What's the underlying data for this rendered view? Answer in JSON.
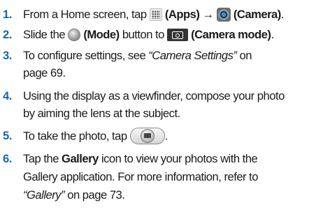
{
  "accent_color": "#1565b5",
  "steps": [
    {
      "num": "1.",
      "line1": {
        "t1": "From a Home screen, tap ",
        "apps": "(Apps)",
        "arrow": " → ",
        "camera": "(Camera)",
        "end": "."
      }
    },
    {
      "num": "2.",
      "line1": {
        "t1": "Slide the ",
        "mode": "(Mode)",
        "t2": " button to ",
        "camera_mode": "(Camera mode)",
        "end": "."
      }
    },
    {
      "num": "3.",
      "line1": {
        "t1": "To configure settings, see ",
        "ref": "“Camera Settings”",
        "t2": " on"
      },
      "line2": "page 69."
    },
    {
      "num": "4.",
      "line1": "Using the display as a viewfinder, compose your photo",
      "line2": "by aiming the lens at the subject."
    },
    {
      "num": "5.",
      "line1": {
        "t1": "To take the photo, tap ",
        "end": "."
      }
    },
    {
      "num": "6.",
      "line1": {
        "t1": "Tap the ",
        "gallery": "Gallery",
        "t2": " icon to view your photos with the"
      },
      "line2": "Gallery application. For more information, refer to",
      "line3": {
        "ref": "“Gallery”",
        "t2": " on page 73."
      }
    }
  ],
  "icons": {
    "apps": "apps-grid-icon",
    "camera": "camera-app-icon",
    "mode": "mode-toggle-icon",
    "camera_mode": "camera-mode-icon",
    "shutter": "shutter-button-icon"
  }
}
